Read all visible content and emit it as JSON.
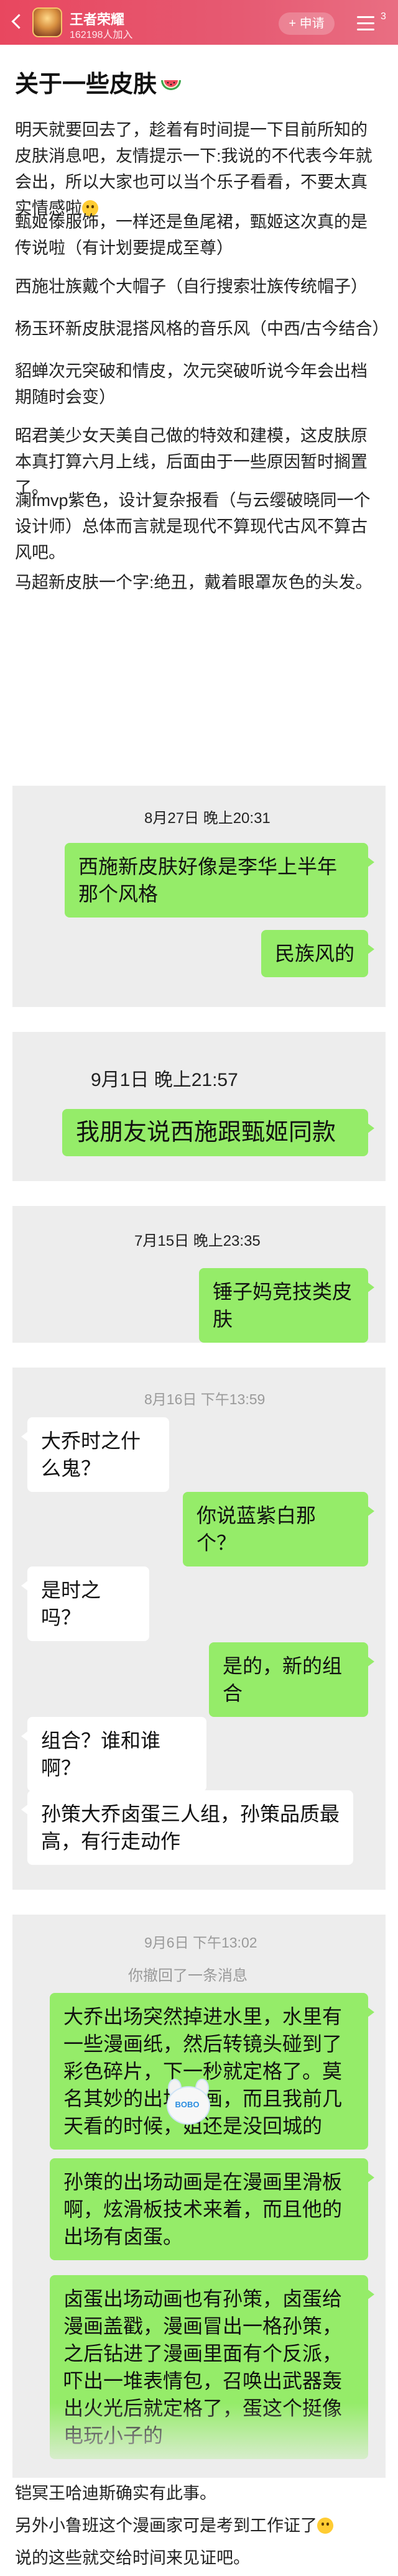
{
  "header": {
    "forum_name": "王者荣耀",
    "members": "162198人加入",
    "apply_label": "+ 申请",
    "notification_count": "3"
  },
  "post": {
    "title": "关于一些皮肤",
    "paragraphs": [
      "明天就要回去了，趁着有时间提一下目前所知的皮肤消息吧，友情提示一下:我说的不代表今年就会出，所以大家也可以当个乐子看看，不要太真实情感啦",
      "甄姬傣服饰，一样还是鱼尾裙，甄姬这次真的是传说啦（有计划要提成至尊）",
      "西施壮族戴个大帽子（自行搜索壮族传统帽子）",
      "杨玉环新皮肤混搭风格的音乐风（中西/古今结合）",
      "貂蝉次元突破和情皮，次元突破听说今年会出档期随时会变）",
      "昭君美少女天美自己做的特效和建模，这皮肤原本真打算六月上线，后面由于一些原因暂时搁置了。",
      "澜fmvp紫色，设计复杂报看（与云缨破晓同一个设计师）总体而言就是现代不算现代古风不算古风吧。",
      "马超新皮肤一个字:绝丑，戴着眼罩灰色的头发。"
    ],
    "closing": [
      "铠冥王哈迪斯确实有此事。",
      "另外小鲁班这个漫画家可是考到工作证了",
      "说的这些就交给时间来见证吧。"
    ]
  },
  "chat1": {
    "timestamp": "8月27日 晚上20:31",
    "messages": [
      "西施新皮肤好像是李华上半年那个风格",
      "民族风的"
    ]
  },
  "chat2": {
    "timestamp": "9月1日 晚上21:57",
    "messages": [
      "我朋友说西施跟甄姬同款"
    ]
  },
  "chat3": {
    "timestamp": "7月15日 晚上23:35",
    "messages": [
      "锤子妈竞技类皮肤"
    ]
  },
  "chat4": {
    "timestamp": "8月16日 下午13:59",
    "messages": [
      "大乔时之什么鬼？",
      "你说蓝紫白那个？",
      "是时之吗？",
      "是的，新的组合",
      "组合？谁和谁啊？",
      "孙策大乔卤蛋三人组，孙策品质最高，有行走动作"
    ]
  },
  "chat5": {
    "timestamp": "9月6日 下午13:02",
    "system": "你撤回了一条消息",
    "messages": [
      "大乔出场突然掉进水里，水里有一些漫画纸，然后转镜头碰到了彩色碎片，下一秒就定格了。莫名其妙的出场动画，而且我前几天看的时候，姐还是没回城的",
      "孙策的出场动画是在漫画里滑板啊，炫滑板技术来着，而且他的出场有卤蛋。",
      "卤蛋出场动画也有孙策，卤蛋给漫画盖戳，漫画冒出一格孙策，之后钻进了漫画里面有个反派，吓出一堆表情包，召唤出武器轰出火光后就定格了，蛋这个挺像电玩小子的"
    ],
    "sticker_label": "BOBO"
  },
  "colors": {
    "header": "#e8475f",
    "chat_bg": "#ededed",
    "bubble_green": "#95ec69",
    "bubble_white": "#ffffff"
  }
}
